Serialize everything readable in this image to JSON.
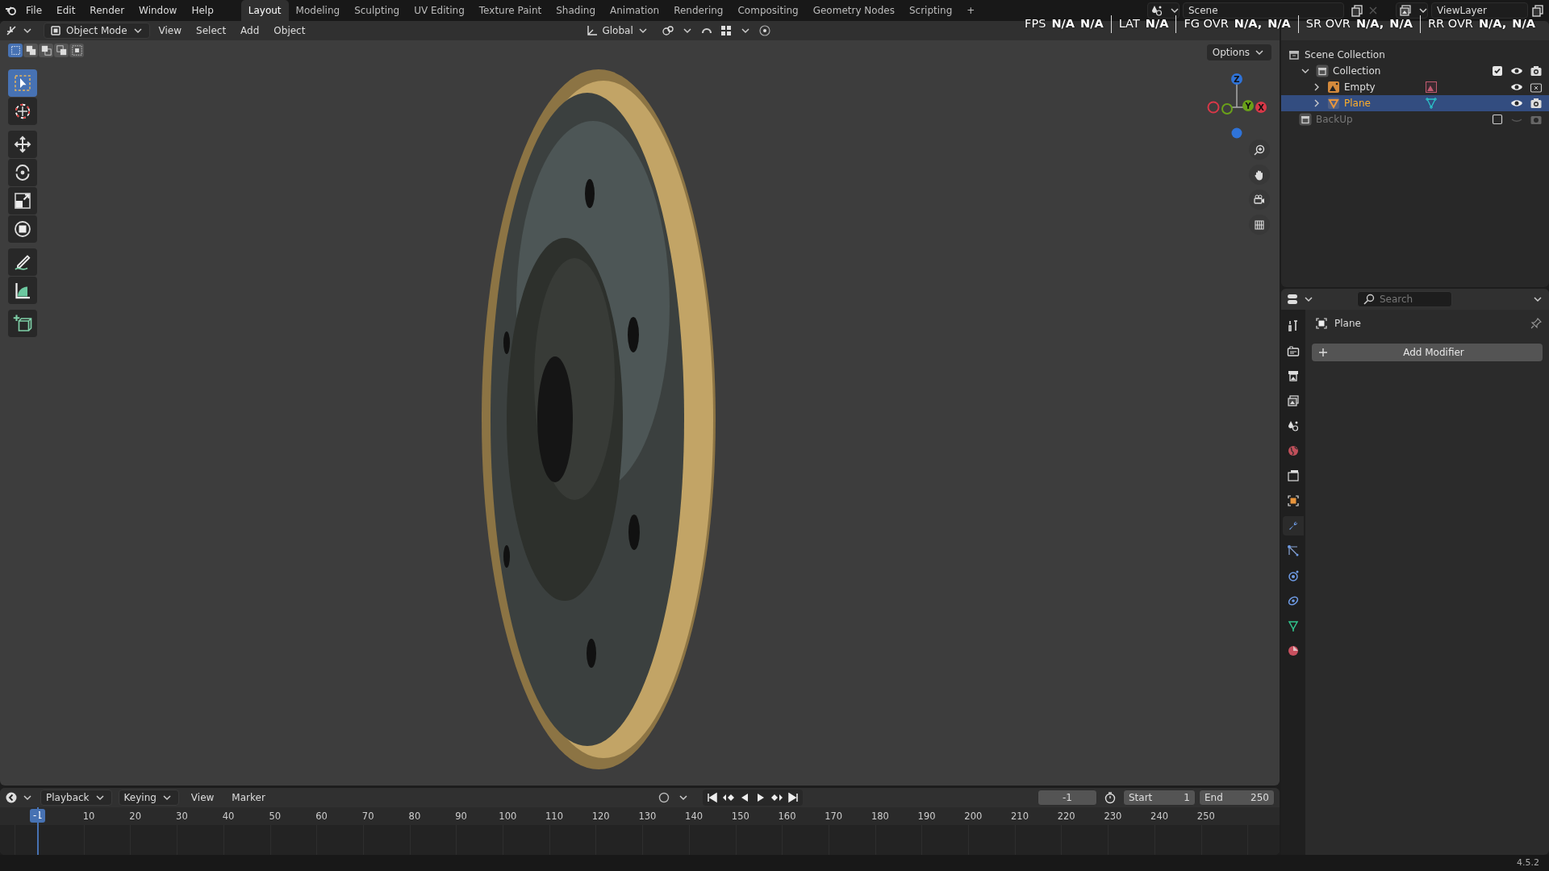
{
  "topbar": {
    "menus": [
      "File",
      "Edit",
      "Render",
      "Window",
      "Help"
    ],
    "workspaces": [
      {
        "label": "Layout",
        "selected": true
      },
      {
        "label": "Modeling",
        "selected": false
      },
      {
        "label": "Sculpting",
        "selected": false
      },
      {
        "label": "UV Editing",
        "selected": false
      },
      {
        "label": "Texture Paint",
        "selected": false
      },
      {
        "label": "Shading",
        "selected": false
      },
      {
        "label": "Animation",
        "selected": false
      },
      {
        "label": "Rendering",
        "selected": false
      },
      {
        "label": "Compositing",
        "selected": false
      },
      {
        "label": "Geometry Nodes",
        "selected": false
      },
      {
        "label": "Scripting",
        "selected": false
      }
    ],
    "add_tab": "+",
    "scene": "Scene",
    "view_layer": "ViewLayer"
  },
  "stats_overlay": [
    {
      "label": "FPS",
      "values": [
        "N/A",
        "N/A"
      ]
    },
    {
      "label": "LAT",
      "values": [
        "N/A"
      ]
    },
    {
      "label": "FG OVR",
      "values": [
        "N/A,",
        "N/A"
      ]
    },
    {
      "label": "SR OVR",
      "values": [
        "N/A,",
        "N/A"
      ]
    },
    {
      "label": "RR OVR",
      "values": [
        "N/A,",
        "N/A"
      ]
    }
  ],
  "viewport": {
    "mode": "Object Mode",
    "menus": [
      "View",
      "Select",
      "Add",
      "Object"
    ],
    "orientation": "Global",
    "options": "Options",
    "select_modes": [
      {
        "selected": true
      },
      {
        "selected": false
      },
      {
        "selected": false
      },
      {
        "selected": false
      },
      {
        "selected": false
      }
    ],
    "tools": [
      {
        "kind": "select",
        "selected": true
      },
      {
        "kind": "cursor",
        "selected": false
      },
      {
        "kind": "move",
        "selected": false
      },
      {
        "kind": "rotate",
        "selected": false
      },
      {
        "kind": "scale",
        "selected": false
      },
      {
        "kind": "transform",
        "selected": false
      },
      {
        "kind": "annotate",
        "selected": false
      },
      {
        "kind": "measure",
        "selected": false
      },
      {
        "kind": "add_cube",
        "selected": false
      }
    ],
    "gizmo_labels": [
      "Z",
      "Y",
      "X"
    ]
  },
  "outliner": {
    "rows": [
      {
        "label": "Scene Collection",
        "kind": "scene",
        "selected": false,
        "children": [
          {
            "label": "Collection",
            "kind": "collection",
            "expanded": true,
            "checked": true,
            "visible": true,
            "renderable": true,
            "disabled": false,
            "selected": false,
            "children": [
              {
                "label": "Empty",
                "kind": "empty",
                "expanded": false,
                "visible": true,
                "renderable": false,
                "disabled": false,
                "selected": false
              },
              {
                "label": "Plane",
                "kind": "mesh",
                "expanded": false,
                "visible": true,
                "renderable": true,
                "disabled": false,
                "selected": true
              }
            ]
          },
          {
            "label": "BackUp",
            "kind": "collection",
            "checked": false,
            "visible": false,
            "renderable": true,
            "disabled": true,
            "selected": false
          }
        ]
      }
    ]
  },
  "properties": {
    "search_placeholder": "Search",
    "object_name": "Plane",
    "add_button": "Add Modifier",
    "tabs": [
      {
        "kind": "tool",
        "selected": false
      },
      {
        "kind": "render",
        "selected": false
      },
      {
        "kind": "output",
        "selected": false
      },
      {
        "kind": "view_layer",
        "selected": false
      },
      {
        "kind": "scene",
        "selected": false
      },
      {
        "kind": "world",
        "selected": false
      },
      {
        "kind": "collection",
        "selected": false
      },
      {
        "kind": "object",
        "selected": false
      },
      {
        "kind": "modifier",
        "selected": true
      },
      {
        "kind": "particles",
        "selected": false
      },
      {
        "kind": "physics",
        "selected": false
      },
      {
        "kind": "constraints",
        "selected": false
      },
      {
        "kind": "data",
        "selected": false
      },
      {
        "kind": "material",
        "selected": false
      }
    ]
  },
  "timeline": {
    "menus": [
      {
        "label": "Playback",
        "dropdown": true
      },
      {
        "label": "Keying",
        "dropdown": true
      },
      {
        "label": "View",
        "dropdown": false
      },
      {
        "label": "Marker",
        "dropdown": false
      }
    ],
    "current_frame": "-1",
    "start_label": "Start",
    "start": "1",
    "end_label": "End",
    "end": "250",
    "frame_marker": "-1",
    "ticks": [
      "10",
      "20",
      "30",
      "40",
      "50",
      "60",
      "70",
      "80",
      "90",
      "100",
      "110",
      "120",
      "130",
      "140",
      "150",
      "160",
      "170",
      "180",
      "190",
      "200",
      "210",
      "220",
      "230",
      "240",
      "250"
    ]
  },
  "status_bar": {
    "version": "4.5.2"
  }
}
